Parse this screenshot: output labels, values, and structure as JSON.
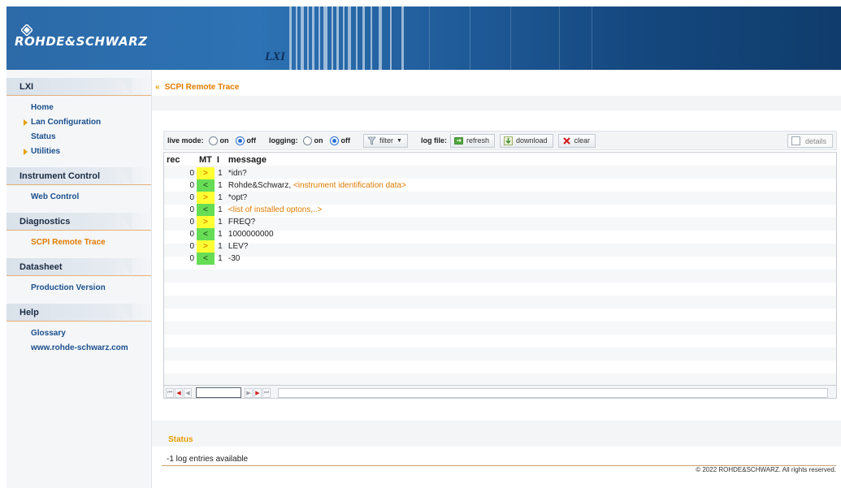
{
  "header": {
    "brand": "ROHDE&SCHWARZ",
    "lxi_label": "LXI"
  },
  "sidebar": {
    "sections": [
      {
        "title": "LXI",
        "items": [
          {
            "label": "Home",
            "arrow": false
          },
          {
            "label": "Lan Configuration",
            "arrow": true
          },
          {
            "label": "Status",
            "arrow": false
          },
          {
            "label": "Utilities",
            "arrow": true
          }
        ]
      },
      {
        "title": "Instrument Control",
        "items": [
          {
            "label": "Web Control",
            "arrow": false
          }
        ]
      },
      {
        "title": "Diagnostics",
        "items": [
          {
            "label": "SCPI Remote Trace",
            "arrow": false,
            "active": true
          }
        ]
      },
      {
        "title": "Datasheet",
        "items": [
          {
            "label": "Production Version",
            "arrow": false
          }
        ]
      },
      {
        "title": "Help",
        "items": [
          {
            "label": "Glossary",
            "arrow": false
          },
          {
            "label": "www.rohde-schwarz.com",
            "arrow": false
          }
        ]
      }
    ]
  },
  "page": {
    "title": "SCPI Remote Trace"
  },
  "toolbar": {
    "live_mode_label": "live mode:",
    "logging_label": "logging:",
    "on_label": "on",
    "off_label": "off",
    "filter_label": "filter",
    "log_file_label": "log file:",
    "refresh_label": "refresh",
    "download_label": "download",
    "clear_label": "clear",
    "details_label": "details",
    "live_mode": "off",
    "logging": "off"
  },
  "trace": {
    "columns": {
      "rec": "rec",
      "mt": "MT",
      "level": "I",
      "message": "message"
    },
    "rows": [
      {
        "rec": "0",
        "mt": ">",
        "dir": "out",
        "level": "1",
        "message": "*idn?",
        "extra": ""
      },
      {
        "rec": "0",
        "mt": "<",
        "dir": "in",
        "level": "1",
        "message": "Rohde&Schwarz,",
        "extra": "<instrument identification data>"
      },
      {
        "rec": "0",
        "mt": ">",
        "dir": "out",
        "level": "1",
        "message": "*opt?",
        "extra": ""
      },
      {
        "rec": "0",
        "mt": "<",
        "dir": "in",
        "level": "1",
        "message": "",
        "extra": "<list of installed optons,..>"
      },
      {
        "rec": "0",
        "mt": ">",
        "dir": "out",
        "level": "1",
        "message": "FREQ?",
        "extra": ""
      },
      {
        "rec": "0",
        "mt": "<",
        "dir": "in",
        "level": "1",
        "message": "1000000000",
        "extra": ""
      },
      {
        "rec": "0",
        "mt": ">",
        "dir": "out",
        "level": "1",
        "message": "LEV?",
        "extra": ""
      },
      {
        "rec": "0",
        "mt": "<",
        "dir": "in",
        "level": "1",
        "message": "-30",
        "extra": ""
      }
    ]
  },
  "status": {
    "title": "Status",
    "text": "-1 log entries available"
  },
  "footer": {
    "copyright": "© 2022 ROHDE&SCHWARZ. All rights reserved."
  },
  "colors": {
    "accent": "#e07b00",
    "link": "#1b4f8c",
    "out_bg": "#ffff33",
    "in_bg": "#66dd55"
  }
}
